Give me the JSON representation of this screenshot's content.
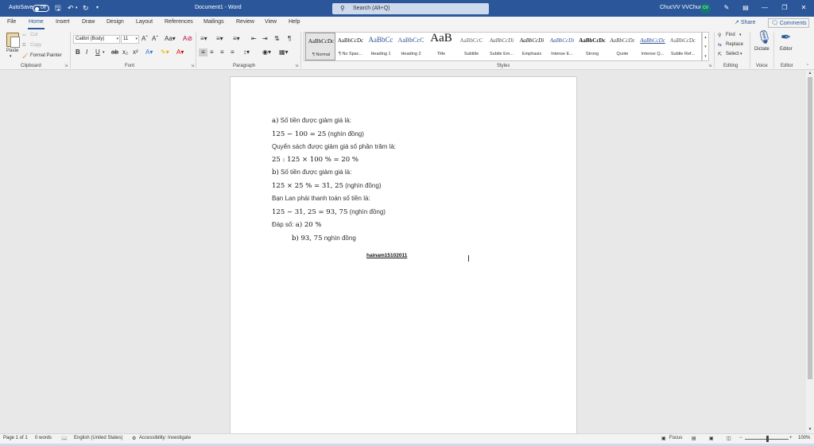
{
  "titlebar": {
    "autosave_label": "AutoSave",
    "autosave_state": "Off",
    "doc_title": "Document1 - Word",
    "search_placeholder": "Search (Alt+Q)",
    "user_name": "ChucVV VVChuc",
    "user_initials": "CV"
  },
  "tabs": [
    "File",
    "Home",
    "Insert",
    "Draw",
    "Design",
    "Layout",
    "References",
    "Mailings",
    "Review",
    "View",
    "Help"
  ],
  "active_tab": "Home",
  "share_label": "Share",
  "comments_label": "Comments",
  "clipboard": {
    "paste": "Paste",
    "cut": "Cut",
    "copy": "Copy",
    "format_painter": "Format Painter",
    "group": "Clipboard"
  },
  "font": {
    "name": "Calibri (Body)",
    "size": "11",
    "group": "Font"
  },
  "paragraph": {
    "group": "Paragraph"
  },
  "styles": {
    "group": "Styles",
    "items": [
      {
        "preview": "AaBbCcDc",
        "name": "¶ Normal"
      },
      {
        "preview": "AaBbCcDc",
        "name": "¶ No Spac..."
      },
      {
        "preview": "AaBbCc",
        "name": "Heading 1"
      },
      {
        "preview": "AaBbCcC",
        "name": "Heading 2"
      },
      {
        "preview": "AaB",
        "name": "Title"
      },
      {
        "preview": "AaBbCcC",
        "name": "Subtitle"
      },
      {
        "preview": "AaBbCcDi",
        "name": "Subtle Em..."
      },
      {
        "preview": "AaBbCcDi",
        "name": "Emphasis"
      },
      {
        "preview": "AaBbCcDi",
        "name": "Intense E..."
      },
      {
        "preview": "AaBbCcDc",
        "name": "Strong"
      },
      {
        "preview": "AaBbCcDc",
        "name": "Quote"
      },
      {
        "preview": "AaBbCcDc",
        "name": "Intense Q..."
      },
      {
        "preview": "AaBbCcDc",
        "name": "Subtle Ref..."
      }
    ]
  },
  "editing": {
    "find": "Find",
    "replace": "Replace",
    "select": "Select",
    "group": "Editing"
  },
  "voice": {
    "dictate": "Dictate",
    "group": "Voice"
  },
  "editor": {
    "label": "Editor",
    "group": "Editor"
  },
  "document": {
    "lines": [
      {
        "math": "a)",
        "text": " Số tiền được giảm giá là:"
      },
      {
        "math": "125 − 100 = 25",
        "text": " (nghìn đồng)"
      },
      {
        "math": "",
        "text": "Quyển sách được giảm giá số phần trăm là:"
      },
      {
        "math": "25 : 125 × 100 % = 20 %",
        "text": ""
      },
      {
        "math": "b)",
        "text": " Số tiền được giảm giá là:"
      },
      {
        "math": "125 × 25 % = 31, 25",
        "text": " (nghìn đồng)"
      },
      {
        "math": "",
        "text": "Bạn Lan phải thanh toán số tiền là:"
      },
      {
        "math": "125 − 31, 25 = 93, 75",
        "text": " (nghìn đồng)"
      },
      {
        "prefix": "Đáp số: ",
        "math": "a) 20 %",
        "text": ""
      },
      {
        "math": "b) 93, 75",
        "text": " nghìn đồng"
      }
    ],
    "signature": "hainam15102011"
  },
  "status": {
    "page": "Page 1 of 1",
    "words": "0 words",
    "language": "English (United States)",
    "accessibility": "Accessibility: Investigate",
    "focus": "Focus",
    "zoom": "100%"
  }
}
